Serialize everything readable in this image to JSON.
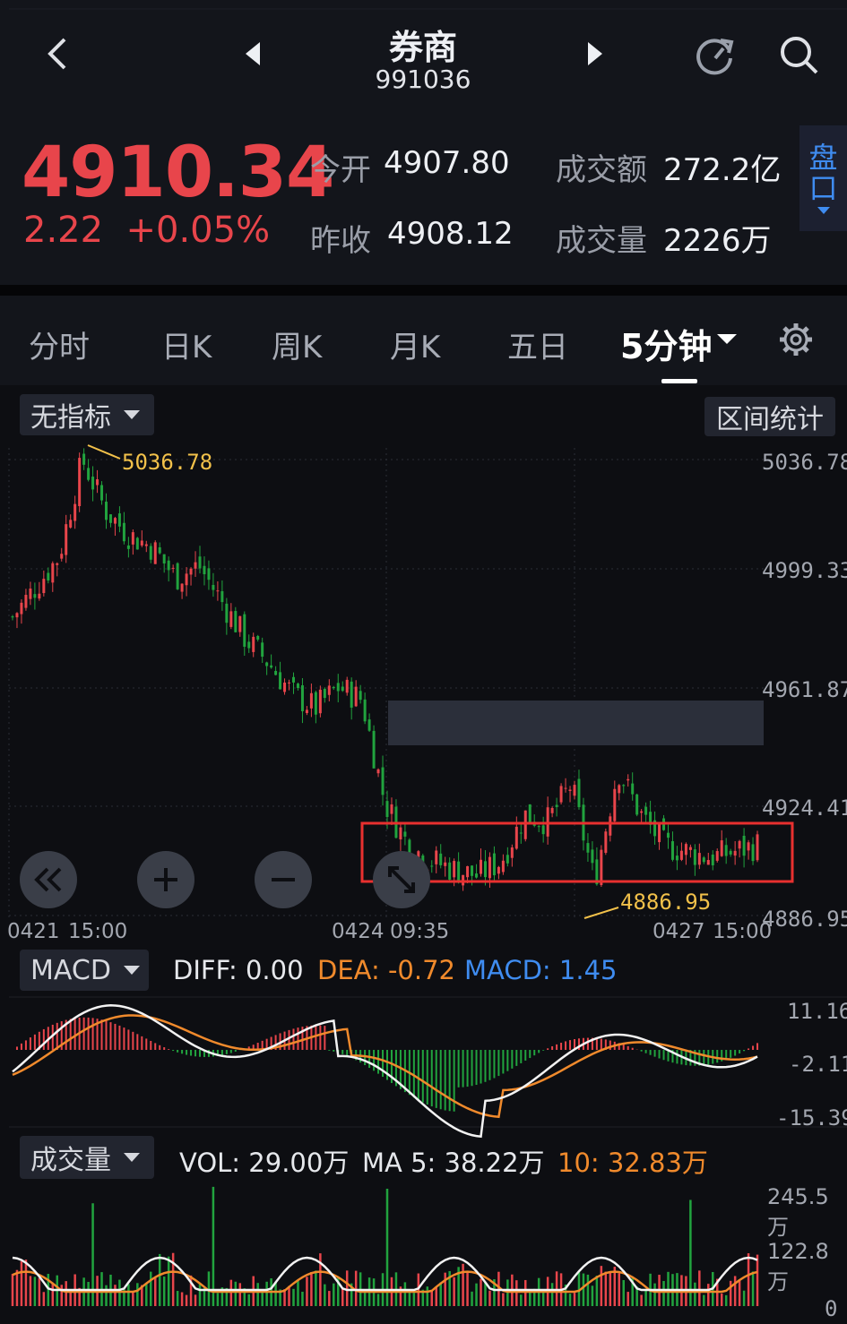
{
  "header": {
    "title": "券商",
    "code": "991036"
  },
  "quote": {
    "price": "4910.34",
    "change": "2.22",
    "change_pct": "+0.05%",
    "open_label": "今开",
    "open_value": "4907.80",
    "prev_close_label": "昨收",
    "prev_close_value": "4908.12",
    "amount_label": "成交额",
    "amount_value": "272.2亿",
    "volume_label": "成交量",
    "volume_value": "2226万",
    "pankou_label_1": "盘",
    "pankou_label_2": "口"
  },
  "tabs": [
    "分时",
    "日K",
    "周K",
    "月K",
    "五日",
    "5分钟"
  ],
  "active_tab": "5分钟",
  "indicator_selector": "无指标",
  "range_stats_button": "区间统计",
  "main_chart": {
    "y_ticks": [
      "5036.78",
      "4999.33",
      "4961.87",
      "4924.41",
      "4886.95"
    ],
    "high_label": "5036.78",
    "low_label": "4886.95",
    "x_labels": [
      "0421",
      "15:00",
      "0424",
      "09:35",
      "0427",
      "15:00"
    ]
  },
  "macd": {
    "selector": "MACD",
    "diff": "DIFF: 0.00",
    "dea": "DEA: -0.72",
    "macd": "MACD: 1.45",
    "y_ticks": [
      "11.16",
      "-2.11",
      "-15.39"
    ]
  },
  "volume": {
    "selector": "成交量",
    "vol": "VOL: 29.00万",
    "ma5": "MA 5: 38.22万",
    "ma10": "10: 32.83万",
    "y_ticks": [
      "245.5万",
      "122.8万",
      "0"
    ]
  },
  "colors": {
    "up": "#e8454b",
    "down": "#21a33e",
    "accent_blue": "#3f8cf0",
    "orange": "#f08a2c",
    "label_yellow": "#f2c14a"
  },
  "chart_data": {
    "type": "candlestick",
    "interval": "5分钟",
    "ylim": [
      4886.95,
      5036.78
    ],
    "high": 5036.78,
    "low": 4886.95,
    "x_labels": [
      "0421 15:00",
      "0424 09:35",
      "0427 15:00"
    ],
    "close_path": [
      4985,
      4995,
      5005,
      5036.78,
      5020,
      5012,
      5008,
      4998,
      5002,
      4990,
      4978,
      4970,
      4960,
      4955,
      4962,
      4958,
      4924,
      4910,
      4905,
      4902,
      4900,
      4905,
      4920,
      4918,
      4930,
      4898,
      4935,
      4920,
      4910,
      4908,
      4906,
      4908,
      4910
    ]
  }
}
